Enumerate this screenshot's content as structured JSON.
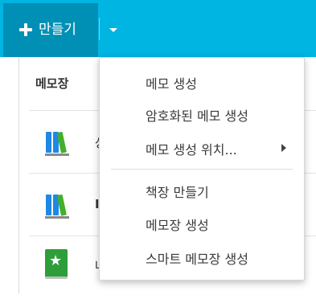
{
  "toolbar": {
    "create_label": "만들기"
  },
  "list": {
    "header": "메모장",
    "rows": [
      {
        "text": "상",
        "icon": "bookshelf-icon"
      },
      {
        "text": "I",
        "icon": "bookshelf-icon"
      },
      {
        "text": "나",
        "icon": "star-notebook-icon"
      }
    ]
  },
  "menu": {
    "items": [
      {
        "label": "메모 생성"
      },
      {
        "label": "암호화된 메모 생성"
      },
      {
        "label": "메모 생성 위치..."
      },
      {
        "label": "책장 만들기"
      },
      {
        "label": "메모장 생성"
      },
      {
        "label": "스마트 메모장 생성"
      }
    ]
  },
  "colors": {
    "topbar": "#00b5e2",
    "create_button": "#0090b5",
    "book_blue": "#1e88e5",
    "book_green": "#43b02a",
    "star_notebook": "#2e9e3a"
  }
}
